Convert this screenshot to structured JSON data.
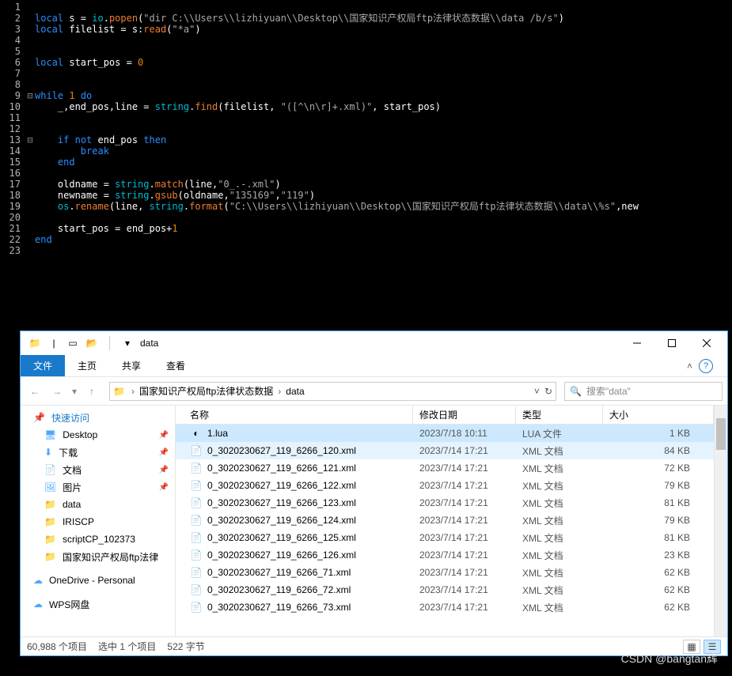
{
  "code": {
    "lines": [
      {
        "n": "1",
        "c": ""
      },
      {
        "n": "2",
        "c": "<k>local</k> s = <f>io</f>.<fn>popen</fn>(<s>\"dir C:\\\\Users\\\\lizhiyuan\\\\Desktop\\\\国家知识产权局ftp法律状态数据\\\\data /b/s\"</s>)"
      },
      {
        "n": "3",
        "c": "<k>local</k> filelist = s:<fn>read</fn>(<s>\"*a\"</s>)"
      },
      {
        "n": "4",
        "c": ""
      },
      {
        "n": "5",
        "c": ""
      },
      {
        "n": "6",
        "c": "<k>local</k> start_pos = <n>0</n>"
      },
      {
        "n": "7",
        "c": ""
      },
      {
        "n": "8",
        "c": ""
      },
      {
        "n": "9",
        "fold": "⊟",
        "c": "<k>while</k> <n>1</n> <k>do</k>"
      },
      {
        "n": "10",
        "c": "    _,end_pos,line = <f>string</f>.<fn>find</fn>(filelist, <s>\"([^\\n\\r]+.xml)\"</s>, start_pos)"
      },
      {
        "n": "11",
        "c": ""
      },
      {
        "n": "12",
        "c": ""
      },
      {
        "n": "13",
        "fold": "⊟",
        "c": "    <k>if</k> <k>not</k> end_pos <k>then</k>"
      },
      {
        "n": "14",
        "c": "        <k>break</k>"
      },
      {
        "n": "15",
        "c": "    <k>end</k>"
      },
      {
        "n": "16",
        "c": ""
      },
      {
        "n": "17",
        "c": "    oldname = <f>string</f>.<fn>match</fn>(line,<s>\"0_.-.xml\"</s>)"
      },
      {
        "n": "18",
        "c": "    newname = <f>string</f>.<fn>gsub</fn>(oldname,<s>\"135169\"</s>,<s>\"119\"</s>)"
      },
      {
        "n": "19",
        "c": "    <f>os</f>.<fn>rename</fn>(line, <f>string</f>.<fn>format</fn>(<s>\"C:\\\\Users\\\\lizhiyuan\\\\Desktop\\\\国家知识产权局ftp法律状态数据\\\\data\\\\%s\"</s>,new"
      },
      {
        "n": "20",
        "c": ""
      },
      {
        "n": "21",
        "c": "    start_pos = end_pos+<n>1</n>"
      },
      {
        "n": "22",
        "c": "<k>end</k>"
      },
      {
        "n": "23",
        "c": ""
      }
    ]
  },
  "explorer": {
    "title": "data",
    "ribbon": {
      "file": "文件",
      "home": "主页",
      "share": "共享",
      "view": "查看"
    },
    "breadcrumb": {
      "parent": "国家知识产权局ftp法律状态数据",
      "current": "data"
    },
    "search_placeholder": "搜索\"data\"",
    "columns": {
      "name": "名称",
      "date": "修改日期",
      "type": "类型",
      "size": "大小"
    },
    "sidebar": {
      "quick": "快速访问",
      "items": [
        {
          "icon": "desktop",
          "label": "Desktop",
          "pin": true
        },
        {
          "icon": "download",
          "label": "下载",
          "pin": true
        },
        {
          "icon": "docs",
          "label": "文档",
          "pin": true
        },
        {
          "icon": "pics",
          "label": "图片",
          "pin": true
        },
        {
          "icon": "folder",
          "label": "data"
        },
        {
          "icon": "folder",
          "label": "IRISCP"
        },
        {
          "icon": "folder",
          "label": "scriptCP_102373"
        },
        {
          "icon": "folder",
          "label": "国家知识产权局ftp法律"
        }
      ],
      "onedrive": "OneDrive - Personal",
      "wps": "WPS网盘"
    },
    "files": [
      {
        "icon": "lua",
        "name": "1.lua",
        "date": "2023/7/18 10:11",
        "type": "LUA 文件",
        "size": "1 KB",
        "sel": true
      },
      {
        "icon": "xml",
        "name": "0_3020230627_119_6266_120.xml",
        "date": "2023/7/14 17:21",
        "type": "XML 文档",
        "size": "84 KB",
        "hov": true
      },
      {
        "icon": "xml",
        "name": "0_3020230627_119_6266_121.xml",
        "date": "2023/7/14 17:21",
        "type": "XML 文档",
        "size": "72 KB"
      },
      {
        "icon": "xml",
        "name": "0_3020230627_119_6266_122.xml",
        "date": "2023/7/14 17:21",
        "type": "XML 文档",
        "size": "79 KB"
      },
      {
        "icon": "xml",
        "name": "0_3020230627_119_6266_123.xml",
        "date": "2023/7/14 17:21",
        "type": "XML 文档",
        "size": "81 KB"
      },
      {
        "icon": "xml",
        "name": "0_3020230627_119_6266_124.xml",
        "date": "2023/7/14 17:21",
        "type": "XML 文档",
        "size": "79 KB"
      },
      {
        "icon": "xml",
        "name": "0_3020230627_119_6266_125.xml",
        "date": "2023/7/14 17:21",
        "type": "XML 文档",
        "size": "81 KB"
      },
      {
        "icon": "xml",
        "name": "0_3020230627_119_6266_126.xml",
        "date": "2023/7/14 17:21",
        "type": "XML 文档",
        "size": "23 KB"
      },
      {
        "icon": "xml",
        "name": "0_3020230627_119_6266_71.xml",
        "date": "2023/7/14 17:21",
        "type": "XML 文档",
        "size": "62 KB"
      },
      {
        "icon": "xml",
        "name": "0_3020230627_119_6266_72.xml",
        "date": "2023/7/14 17:21",
        "type": "XML 文档",
        "size": "62 KB"
      },
      {
        "icon": "xml",
        "name": "0_3020230627_119_6266_73.xml",
        "date": "2023/7/14 17:21",
        "type": "XML 文档",
        "size": "62 KB"
      }
    ],
    "status": {
      "count": "60,988 个项目",
      "sel": "选中 1 个项目",
      "bytes": "522 字节"
    }
  },
  "watermark": "CSDN @bangtan辉"
}
